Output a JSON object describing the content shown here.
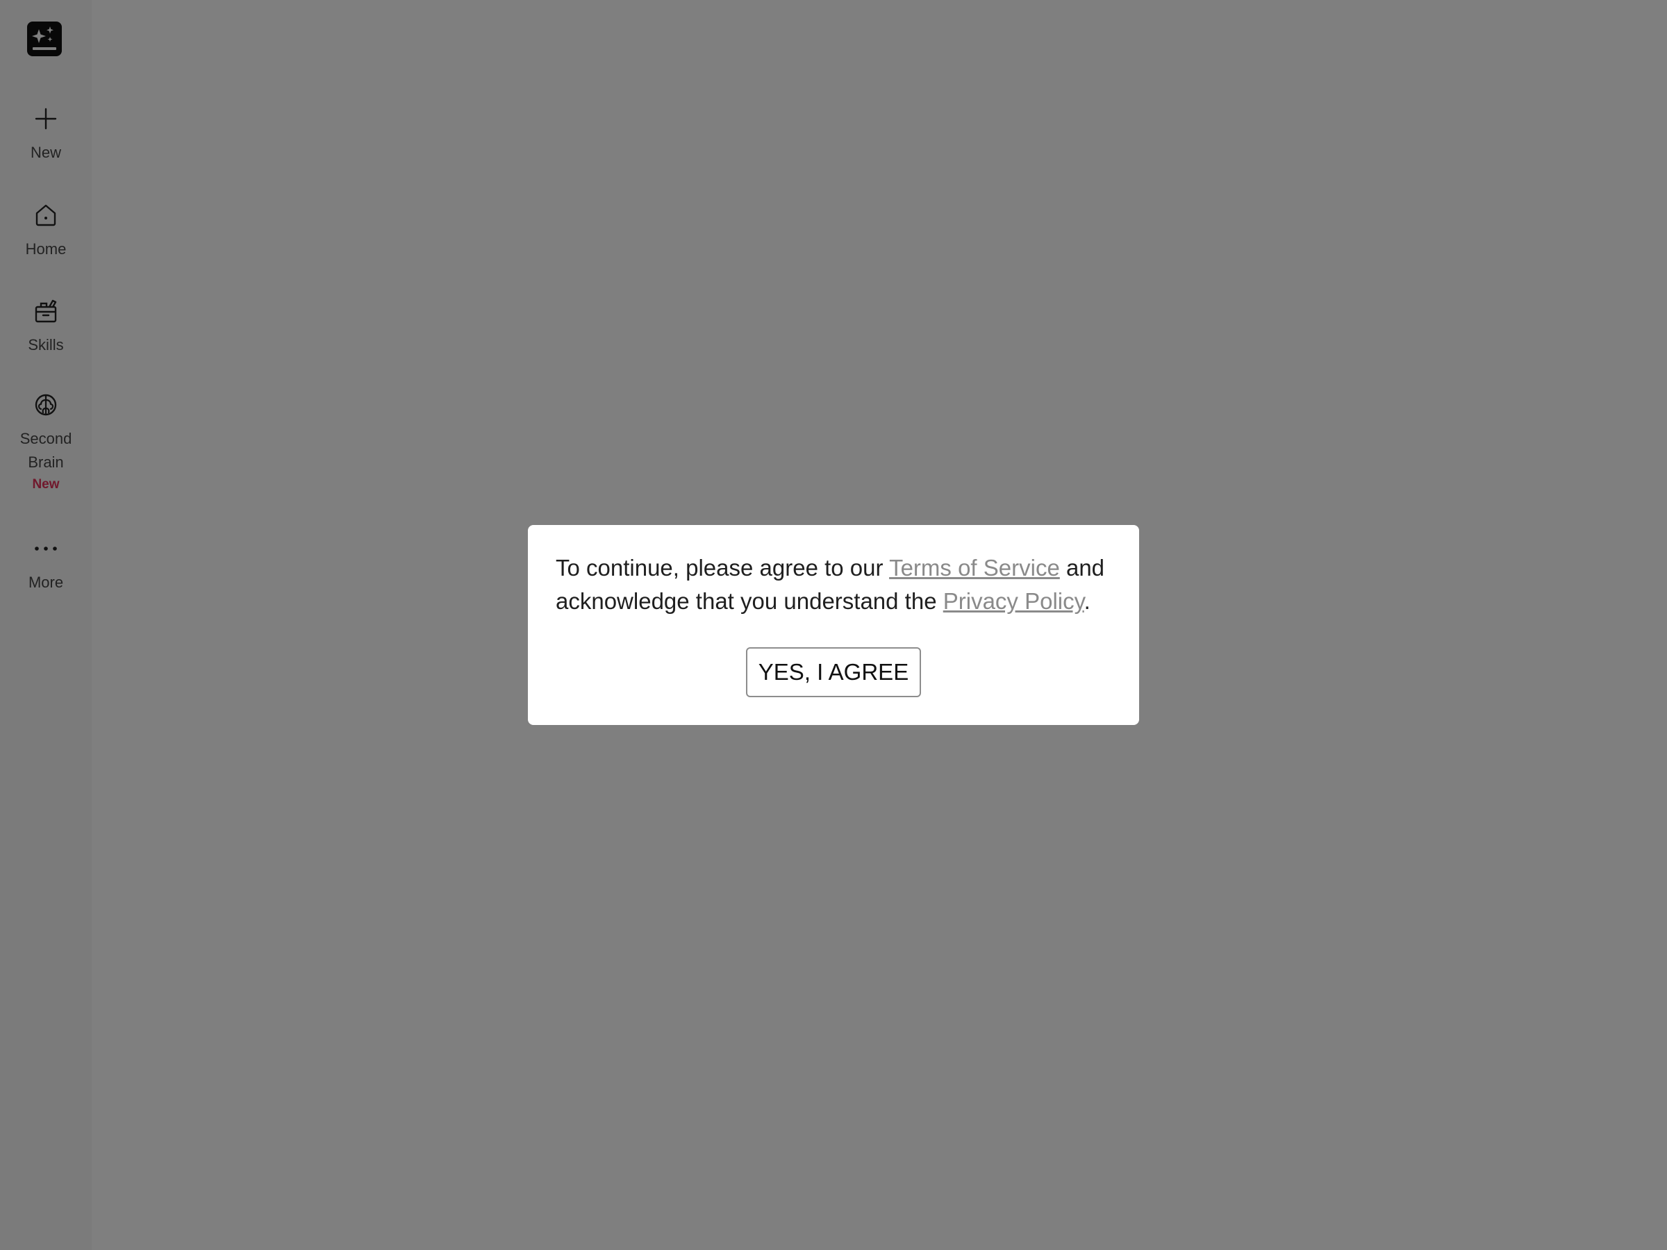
{
  "sidebar": {
    "items": [
      {
        "id": "new",
        "label": "New",
        "icon": "plus-icon"
      },
      {
        "id": "home",
        "label": "Home",
        "icon": "home-icon"
      },
      {
        "id": "skills",
        "label": "Skills",
        "icon": "toolbox-icon"
      },
      {
        "id": "second_brain",
        "label": "Second Brain",
        "badge": "New",
        "icon": "brain-icon"
      },
      {
        "id": "more",
        "label": "More",
        "icon": "more-dots-icon"
      }
    ]
  },
  "dialog": {
    "text_prefix": "To continue, please agree to our ",
    "terms_link": "Terms of Service",
    "text_middle": " and acknowledge that you understand the ",
    "privacy_link": "Privacy Policy",
    "text_suffix": ".",
    "agree_button": "YES, I AGREE"
  },
  "colors": {
    "overlay": "rgba(0,0,0,0.5)",
    "badge": "#e03058",
    "link": "#8a8a8a"
  }
}
